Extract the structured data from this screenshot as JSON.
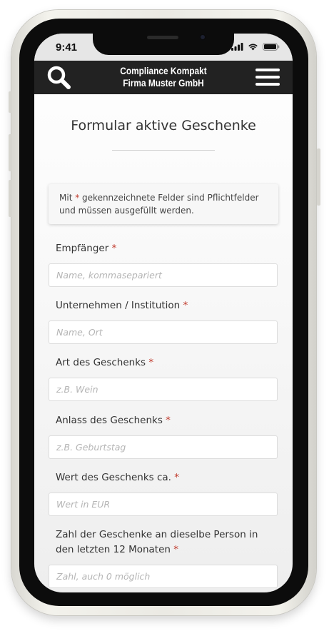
{
  "status": {
    "time": "9:41"
  },
  "header": {
    "title_line1": "Compliance Kompakt",
    "title_line2": "Firma Muster GmbH"
  },
  "form": {
    "title": "Formular aktive Geschenke",
    "notice_prefix": "Mit",
    "required_marker": "*",
    "notice_text": " gekennzeichnete Felder sind Pflichtfelder und müssen ausgefüllt werden.",
    "fields": [
      {
        "label": "Empfänger",
        "placeholder": "Name, kommasepariert"
      },
      {
        "label": "Unternehmen / Institution",
        "placeholder": "Name, Ort"
      },
      {
        "label": "Art des Geschenks",
        "placeholder": "z.B. Wein"
      },
      {
        "label": "Anlass des Geschenks",
        "placeholder": "z.B. Geburtstag"
      },
      {
        "label": "Wert des Geschenks ca.",
        "placeholder": "Wert in EUR"
      },
      {
        "label": "Zahl der Geschenke an dieselbe Person in den letzten 12 Monaten",
        "placeholder": "Zahl, auch 0 möglich"
      }
    ]
  },
  "colors": {
    "appbar": "#222222",
    "required": "#c0392b",
    "phone_frame": "#0c0c0c",
    "phone_shell": "#ebeae4"
  },
  "icons": [
    "search-icon",
    "hamburger-menu-icon",
    "signal-icon",
    "wifi-icon",
    "battery-icon"
  ]
}
